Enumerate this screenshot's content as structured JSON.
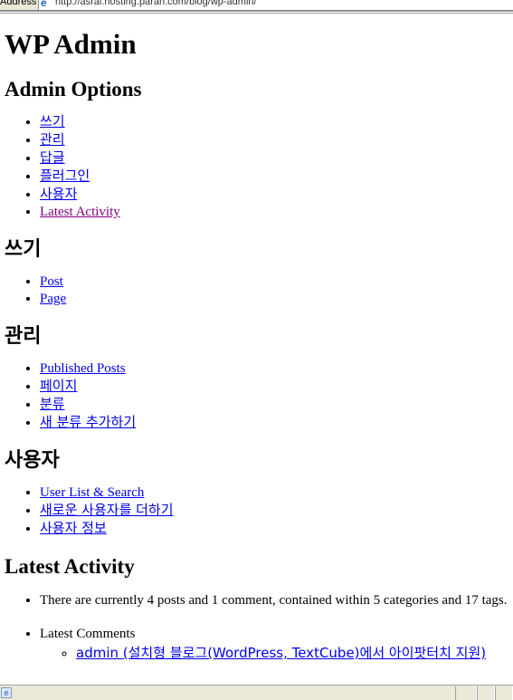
{
  "browser": {
    "address_label": "Address",
    "url": "http://asrai.hosting.paran.com/blog/wp-admin/"
  },
  "page": {
    "title": "WP Admin",
    "admin_options": {
      "heading": "Admin Options",
      "items": [
        "쓰기",
        "관리",
        "답글",
        "플러그인",
        "사용자",
        "Latest Activity"
      ]
    },
    "write": {
      "heading": "쓰기",
      "items": [
        "Post",
        "Page"
      ]
    },
    "manage": {
      "heading": "관리",
      "items": [
        "Published Posts",
        "페이지",
        "분류",
        "새 분류 추가하기"
      ]
    },
    "users": {
      "heading": "사용자",
      "items": [
        "User List & Search",
        "새로운 사용자를 더하기",
        "사용자 정보"
      ]
    },
    "activity": {
      "heading": "Latest Activity",
      "summary": "There are currently 4 posts and 1 comment, contained within 5 categories and 17 tags.",
      "latest_comments_label": "Latest Comments",
      "comment_link": "admin (설치형 블로그(WordPress, TextCube)에서 아이팟터치 지원)"
    }
  }
}
